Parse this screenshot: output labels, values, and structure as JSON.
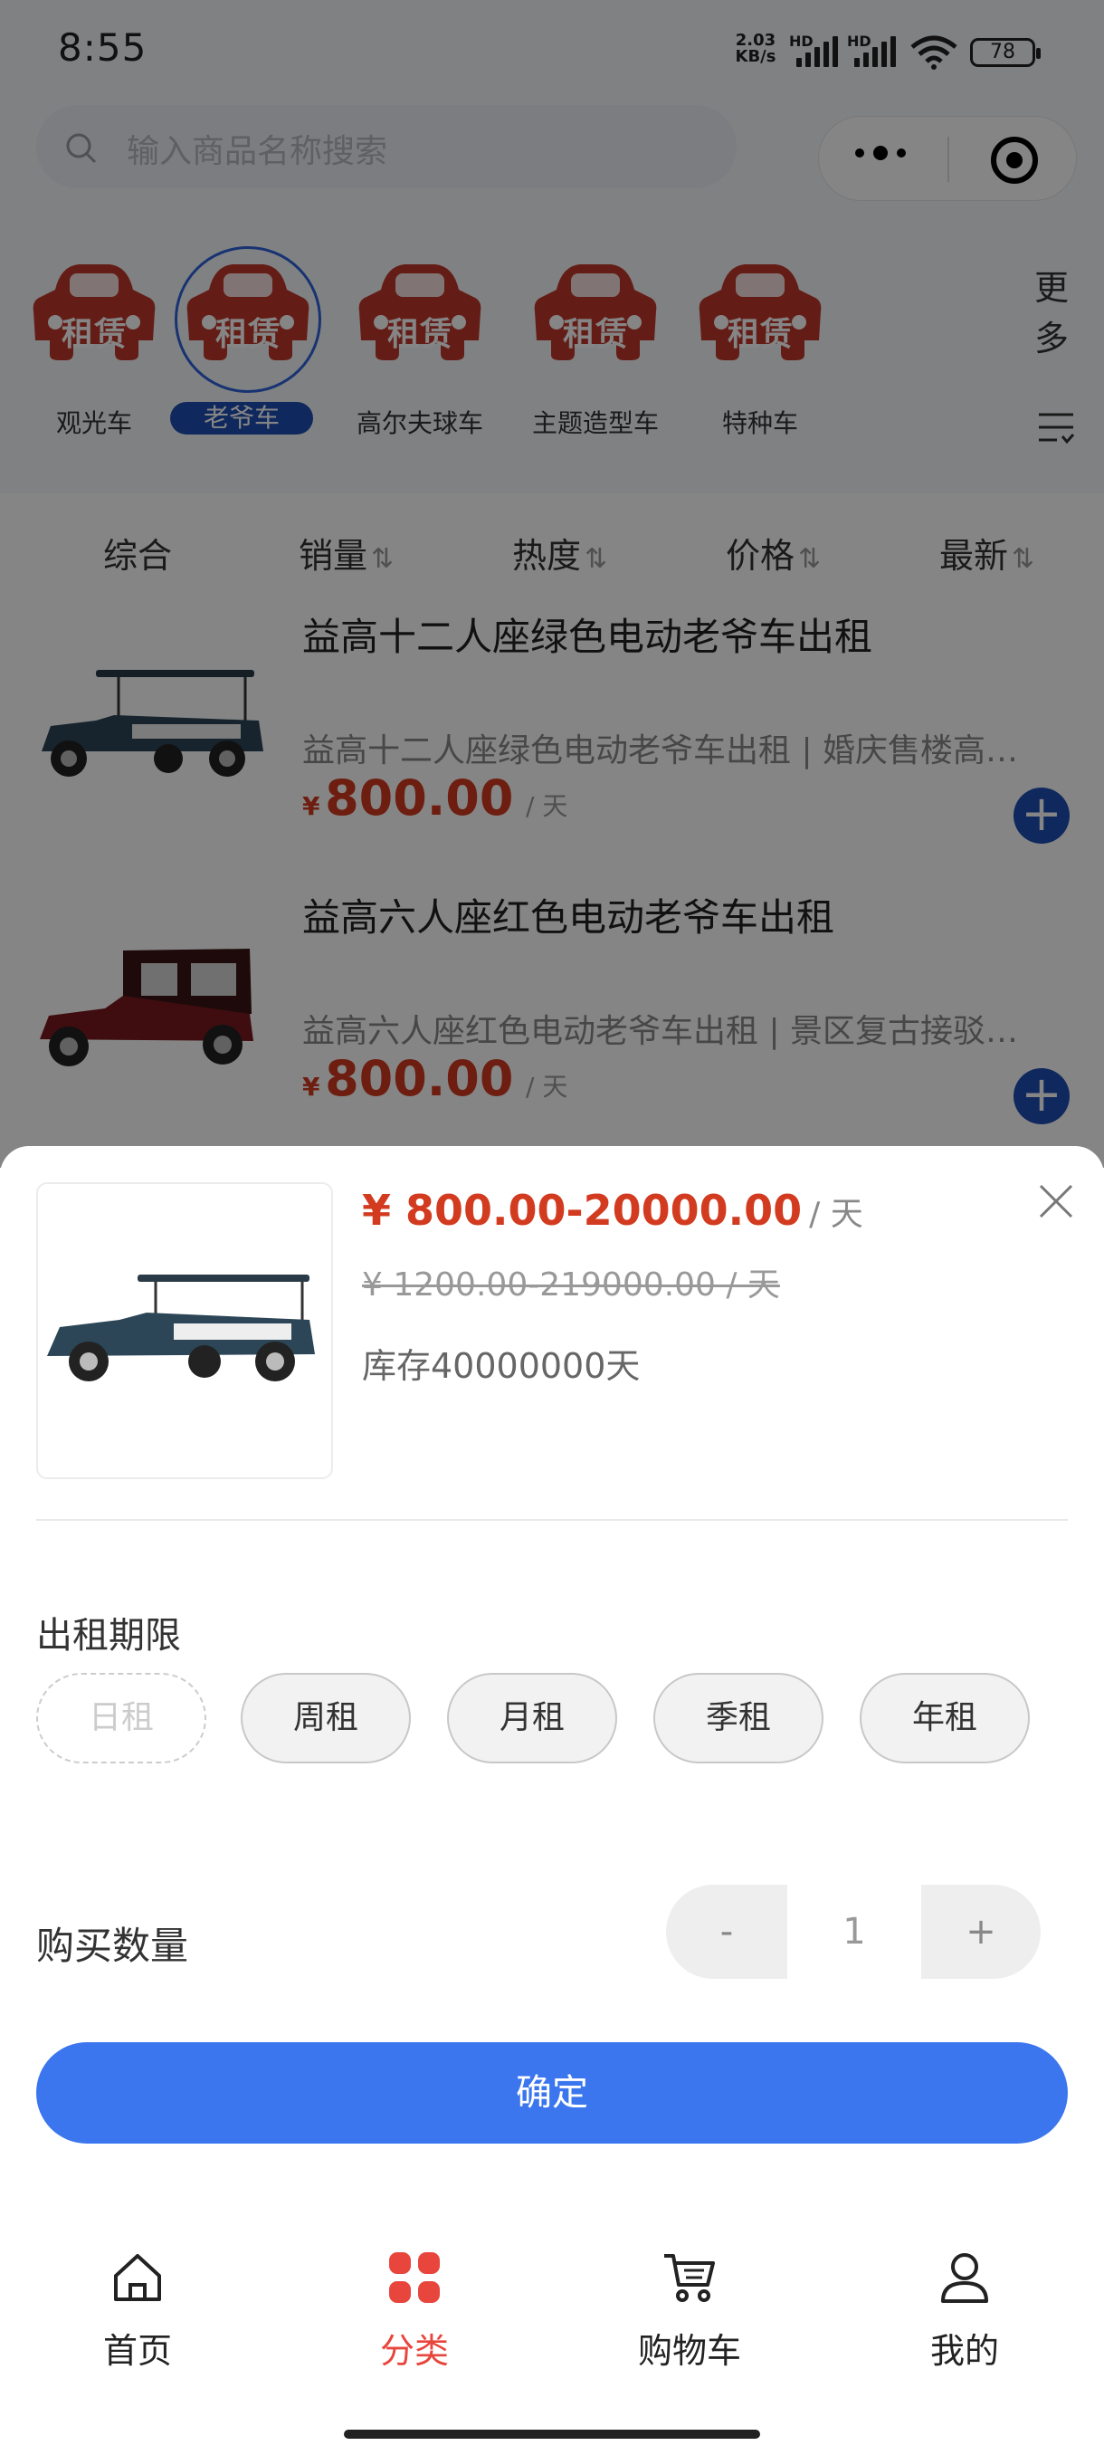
{
  "status_bar": {
    "time": "8:55",
    "net_speed_value": "2.03",
    "net_speed_unit": "KB/s",
    "hd1": "HD",
    "hd2": "HD",
    "battery": "78"
  },
  "search": {
    "placeholder": "输入商品名称搜索"
  },
  "categories": {
    "items": [
      {
        "badge": "租赁",
        "label": "观光车"
      },
      {
        "badge": "租赁",
        "label": "老爷车"
      },
      {
        "badge": "租赁",
        "label": "高尔夫球车"
      },
      {
        "badge": "租赁",
        "label": "主题造型车"
      },
      {
        "badge": "租赁",
        "label": "特种车"
      }
    ],
    "active": "老爷车",
    "more_label_1": "更",
    "more_label_2": "多"
  },
  "sort": {
    "items": [
      {
        "label": "综合",
        "arrow": ""
      },
      {
        "label": "销量",
        "arrow": "⇅"
      },
      {
        "label": "热度",
        "arrow": "⇅"
      },
      {
        "label": "价格",
        "arrow": "⇅"
      },
      {
        "label": "最新",
        "arrow": "⇅"
      }
    ]
  },
  "products": [
    {
      "title": "益高十二人座绿色电动老爷车出租",
      "desc": "益高十二人座绿色电动老爷车出租 | 婚庆售楼高…",
      "currency": "¥",
      "price": "800.00",
      "unit": "/ 天"
    },
    {
      "title": "益高六人座红色电动老爷车出租",
      "desc": "益高六人座红色电动老爷车出租 | 景区复古接驳…",
      "currency": "¥",
      "price": "800.00",
      "unit": "/ 天"
    }
  ],
  "sheet": {
    "price_range": "¥ 800.00-20000.00",
    "price_unit": "/ 天",
    "original_price": "¥ 1200.00-219000.00 / 天",
    "stock": "库存40000000天",
    "period_label": "出租期限",
    "periods": [
      {
        "label": "日租",
        "disabled": true
      },
      {
        "label": "周租",
        "disabled": false
      },
      {
        "label": "月租",
        "disabled": false
      },
      {
        "label": "季租",
        "disabled": false
      },
      {
        "label": "年租",
        "disabled": false
      }
    ],
    "quantity_label": "购买数量",
    "quantity": "1",
    "minus": "-",
    "plus": "+",
    "confirm": "确定"
  },
  "tabbar": {
    "items": [
      {
        "label": "首页"
      },
      {
        "label": "分类"
      },
      {
        "label": "购物车"
      },
      {
        "label": "我的"
      }
    ],
    "active": "分类"
  },
  "colors": {
    "accent_blue": "#3b76ee",
    "price_red": "#d23b1f",
    "badge_red": "#c0392b",
    "tab_active": "#e8453c",
    "category_active": "#1d4db3"
  }
}
